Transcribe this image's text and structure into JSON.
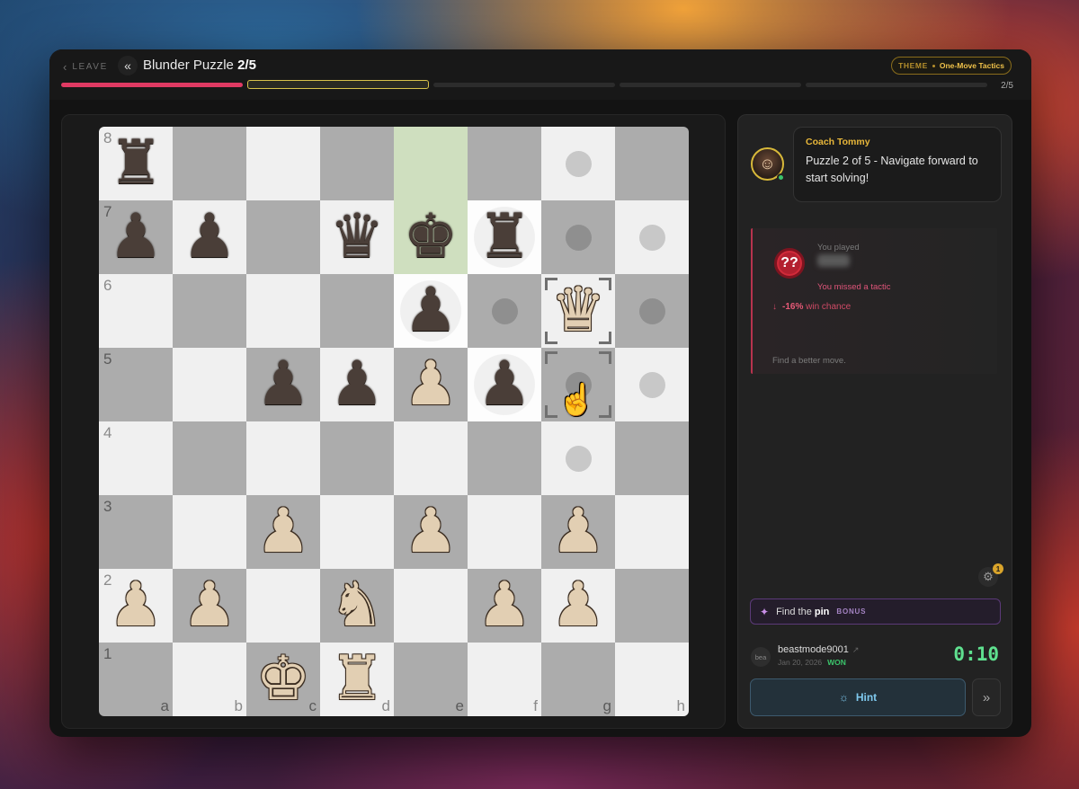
{
  "header": {
    "leave_label": "LEAVE",
    "back_icon": "double-chevron-left-icon",
    "title_prefix": "Blunder Puzzle",
    "title_progress": "2/5",
    "theme_label": "THEME",
    "theme_value": "One-Move Tactics",
    "progress_count": "2/5",
    "progress": {
      "total": 5,
      "completed": 1,
      "current": 2
    }
  },
  "board": {
    "rank_labels": [
      "8",
      "7",
      "6",
      "5",
      "4",
      "3",
      "2",
      "1"
    ],
    "file_labels": [
      "a",
      "b",
      "c",
      "d",
      "e",
      "f",
      "g",
      "h"
    ],
    "highlighted_squares": [
      "e8",
      "e7"
    ],
    "selected_square": "g6",
    "target_square": "g5",
    "move_dots": [
      "g8",
      "g7",
      "h7",
      "f6",
      "h6",
      "g5",
      "h5",
      "g4"
    ],
    "capture_squares": [
      "e6",
      "f7",
      "f5"
    ],
    "pieces": [
      {
        "square": "a8",
        "piece": "rook",
        "color": "black",
        "glyph": "♜"
      },
      {
        "square": "a7",
        "piece": "pawn",
        "color": "black",
        "glyph": "♟"
      },
      {
        "square": "b7",
        "piece": "pawn",
        "color": "black",
        "glyph": "♟"
      },
      {
        "square": "d7",
        "piece": "queen",
        "color": "black",
        "glyph": "♛"
      },
      {
        "square": "e7",
        "piece": "king",
        "color": "black",
        "glyph": "♚"
      },
      {
        "square": "f7",
        "piece": "rook",
        "color": "black",
        "glyph": "♜"
      },
      {
        "square": "e6",
        "piece": "pawn",
        "color": "black",
        "glyph": "♟"
      },
      {
        "square": "g6",
        "piece": "queen",
        "color": "white",
        "glyph": "♛"
      },
      {
        "square": "c5",
        "piece": "pawn",
        "color": "black",
        "glyph": "♟"
      },
      {
        "square": "d5",
        "piece": "pawn",
        "color": "black",
        "glyph": "♟"
      },
      {
        "square": "e5",
        "piece": "pawn",
        "color": "white",
        "glyph": "♟"
      },
      {
        "square": "f5",
        "piece": "pawn",
        "color": "black",
        "glyph": "♟"
      },
      {
        "square": "c3",
        "piece": "pawn",
        "color": "white",
        "glyph": "♟"
      },
      {
        "square": "e3",
        "piece": "pawn",
        "color": "white",
        "glyph": "♟"
      },
      {
        "square": "g3",
        "piece": "pawn",
        "color": "white",
        "glyph": "♟"
      },
      {
        "square": "a2",
        "piece": "pawn",
        "color": "white",
        "glyph": "♟"
      },
      {
        "square": "b2",
        "piece": "pawn",
        "color": "white",
        "glyph": "♟"
      },
      {
        "square": "d2",
        "piece": "knight",
        "color": "white",
        "glyph": "♞"
      },
      {
        "square": "f2",
        "piece": "pawn",
        "color": "white",
        "glyph": "♟"
      },
      {
        "square": "g2",
        "piece": "pawn",
        "color": "white",
        "glyph": "♟"
      },
      {
        "square": "c1",
        "piece": "king",
        "color": "white",
        "glyph": "♚"
      },
      {
        "square": "d1",
        "piece": "rook",
        "color": "white",
        "glyph": "♜"
      }
    ]
  },
  "coach": {
    "name": "Coach Tommy",
    "message": "Puzzle 2 of 5 - Navigate forward to start solving!",
    "status": "online"
  },
  "played": {
    "label": "You played",
    "badge": "??",
    "result": "You missed a tactic",
    "delta": "-16%",
    "delta_label": "win chance",
    "prompt": "Find a better move."
  },
  "settings": {
    "icon": "gear-icon",
    "badge_count": "1"
  },
  "bonus": {
    "prefix": "Find the",
    "highlight": "pin",
    "tag": "BONUS",
    "icon": "sparkle-icon"
  },
  "player": {
    "avatar_text": "bea",
    "name": "beastmode9001",
    "date": "Jan 20, 2026",
    "result": "WON",
    "timer": "0:10"
  },
  "actions": {
    "hint_label": "Hint",
    "hint_icon": "lightbulb-icon",
    "skip_icon": "double-chevron-right-icon"
  },
  "colors": {
    "accent": "#e03a63",
    "gold": "#e8b73a",
    "timer": "#5fe08f",
    "hint": "#7fc9ee"
  }
}
